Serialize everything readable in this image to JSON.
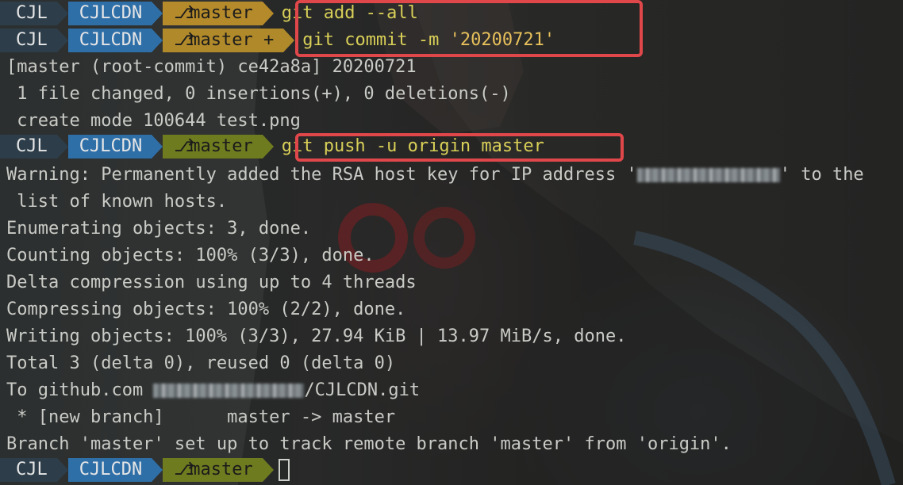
{
  "prompt": {
    "user": "CJL",
    "dir": "CJLCDN",
    "branch": "master",
    "dirty_mark": "+"
  },
  "commands": {
    "add": "git add --all",
    "commit_prefix": "git commit -m ",
    "commit_msg": "'20200721'",
    "push": "git push -u origin master"
  },
  "output": {
    "commit_result": "[master (root-commit) ce42a8a] 20200721",
    "changes": " 1 file changed, 0 insertions(+), 0 deletions(-)",
    "create_mode": " create mode 100644 test.png",
    "warning_a": "Warning: Permanently added the RSA host key for IP address '",
    "warning_b": "' to the",
    "warning_c": " list of known hosts.",
    "enumerating": "Enumerating objects: 3, done.",
    "counting": "Counting objects: 100% (3/3), done.",
    "delta": "Delta compression using up to 4 threads",
    "compressing": "Compressing objects: 100% (2/2), done.",
    "writing": "Writing objects: 100% (3/3), 27.94 KiB | 13.97 MiB/s, done.",
    "total": "Total 3 (delta 0), reused 0 (delta 0)",
    "to_a": "To github.com ",
    "to_b": "/CJLCDN.git",
    "new_branch_a": " * [new branch]",
    "new_branch_b": "master -> master",
    "branch_setup": "Branch 'master' set up to track remote branch 'master' from 'origin'."
  },
  "colors": {
    "highlight": "#e0474a",
    "command": "#d9cf58",
    "dir": "#2f6fa8",
    "user": "#2d3e4a"
  },
  "icons": {
    "branch": "git-branch-icon"
  }
}
